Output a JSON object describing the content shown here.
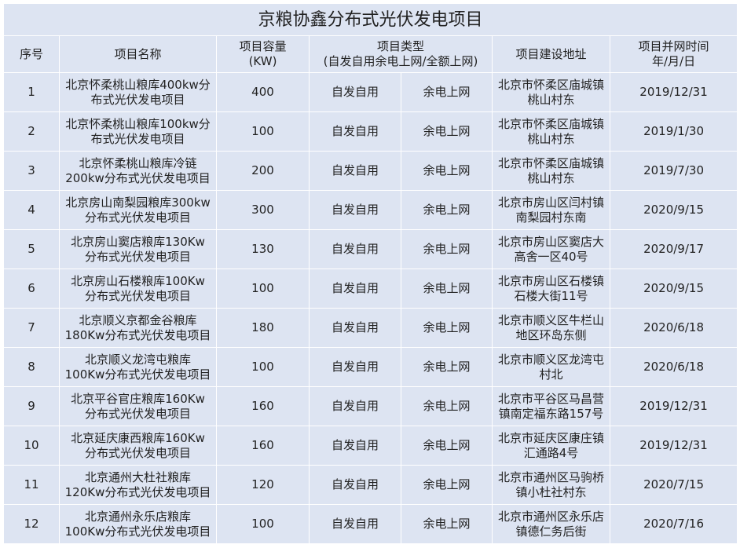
{
  "title": "京粮协鑫分布式光伏发电项目",
  "headers": {
    "seq": "序号",
    "name": "项目名称",
    "capacity_line1": "项目容量",
    "capacity_line2": "(KW)",
    "type_line1": "项目类型",
    "type_line2": "(自发自用余电上网/全额上网)",
    "address": "项目建设地址",
    "time_line1": "项目并网时间",
    "time_line2": "年/月/日"
  },
  "rows": [
    {
      "seq": "1",
      "name1": "北京怀柔桃山粮库400kw分",
      "name2": "布式光伏发电项目",
      "capacity": "400",
      "type1": "自发自用",
      "type2": "余电上网",
      "addr1": "北京市怀柔区庙城镇",
      "addr2": "桃山村东",
      "date": "2019/12/31"
    },
    {
      "seq": "2",
      "name1": "北京怀柔桃山粮库100kw分",
      "name2": "布式光伏发电项目",
      "capacity": "100",
      "type1": "自发自用",
      "type2": "余电上网",
      "addr1": "北京市怀柔区庙城镇",
      "addr2": "桃山村东",
      "date": "2019/1/30"
    },
    {
      "seq": "3",
      "name1": "北京怀柔桃山粮库冷链",
      "name2": "200kw分布式光伏发电项目",
      "capacity": "200",
      "type1": "自发自用",
      "type2": "余电上网",
      "addr1": "北京市怀柔区庙城镇",
      "addr2": "桃山村东",
      "date": "2019/7/30"
    },
    {
      "seq": "4",
      "name1": "北京房山南梨园粮库300kw",
      "name2": "分布式光伏发电项目",
      "capacity": "300",
      "type1": "自发自用",
      "type2": "余电上网",
      "addr1": "北京市房山区闫村镇",
      "addr2": "南梨园村东南",
      "date": "2020/9/15"
    },
    {
      "seq": "5",
      "name1": "北京房山窦店粮库130Kw",
      "name2": "分布式光伏发电项目",
      "capacity": "130",
      "type1": "自发自用",
      "type2": "余电上网",
      "addr1": "北京市房山区窦店大",
      "addr2": "高舍一区40号",
      "date": "2020/9/17"
    },
    {
      "seq": "6",
      "name1": "北京房山石楼粮库100Kw",
      "name2": "分布式光伏发电项目",
      "capacity": "100",
      "type1": "自发自用",
      "type2": "余电上网",
      "addr1": "北京市房山区石楼镇",
      "addr2": "石楼大街11号",
      "date": "2020/9/15"
    },
    {
      "seq": "7",
      "name1": "北京顺义京都金谷粮库",
      "name2": "180Kw分布式光伏发电项目",
      "capacity": "180",
      "type1": "自发自用",
      "type2": "余电上网",
      "addr1": "北京市顺义区牛栏山",
      "addr2": "地区环岛东侧",
      "date": "2020/6/18"
    },
    {
      "seq": "8",
      "name1": "北京顺义龙湾屯粮库",
      "name2": "100Kw分布式光伏发电项目",
      "capacity": "100",
      "type1": "自发自用",
      "type2": "余电上网",
      "addr1": "北京市顺义区龙湾屯",
      "addr2": "村北",
      "date": "2020/6/18"
    },
    {
      "seq": "9",
      "name1": "北京平谷官庄粮库160Kw",
      "name2": "分布式光伏发电项目",
      "capacity": "160",
      "type1": "自发自用",
      "type2": "余电上网",
      "addr1": "北京市平谷区马昌营",
      "addr2": "镇南定福东路157号",
      "date": "2019/12/31"
    },
    {
      "seq": "10",
      "name1": "北京延庆康西粮库160Kw",
      "name2": "分布式光伏发电项目",
      "capacity": "160",
      "type1": "自发自用",
      "type2": "余电上网",
      "addr1": "北京市延庆区康庄镇",
      "addr2": "汇通路4号",
      "date": "2019/12/31"
    },
    {
      "seq": "11",
      "name1": "北京通州大杜社粮库",
      "name2": "120Kw分布式光伏发电项目",
      "capacity": "120",
      "type1": "自发自用",
      "type2": "余电上网",
      "addr1": "北京市通州区马驹桥",
      "addr2": "镇小杜社村东",
      "date": "2020/7/15"
    },
    {
      "seq": "12",
      "name1": "北京通州永乐店粮库",
      "name2": "100Kw分布式光伏发电项目",
      "capacity": "100",
      "type1": "自发自用",
      "type2": "余电上网",
      "addr1": "北京市通州区永乐店",
      "addr2": "镇德仁务后街",
      "date": "2020/7/16"
    }
  ]
}
